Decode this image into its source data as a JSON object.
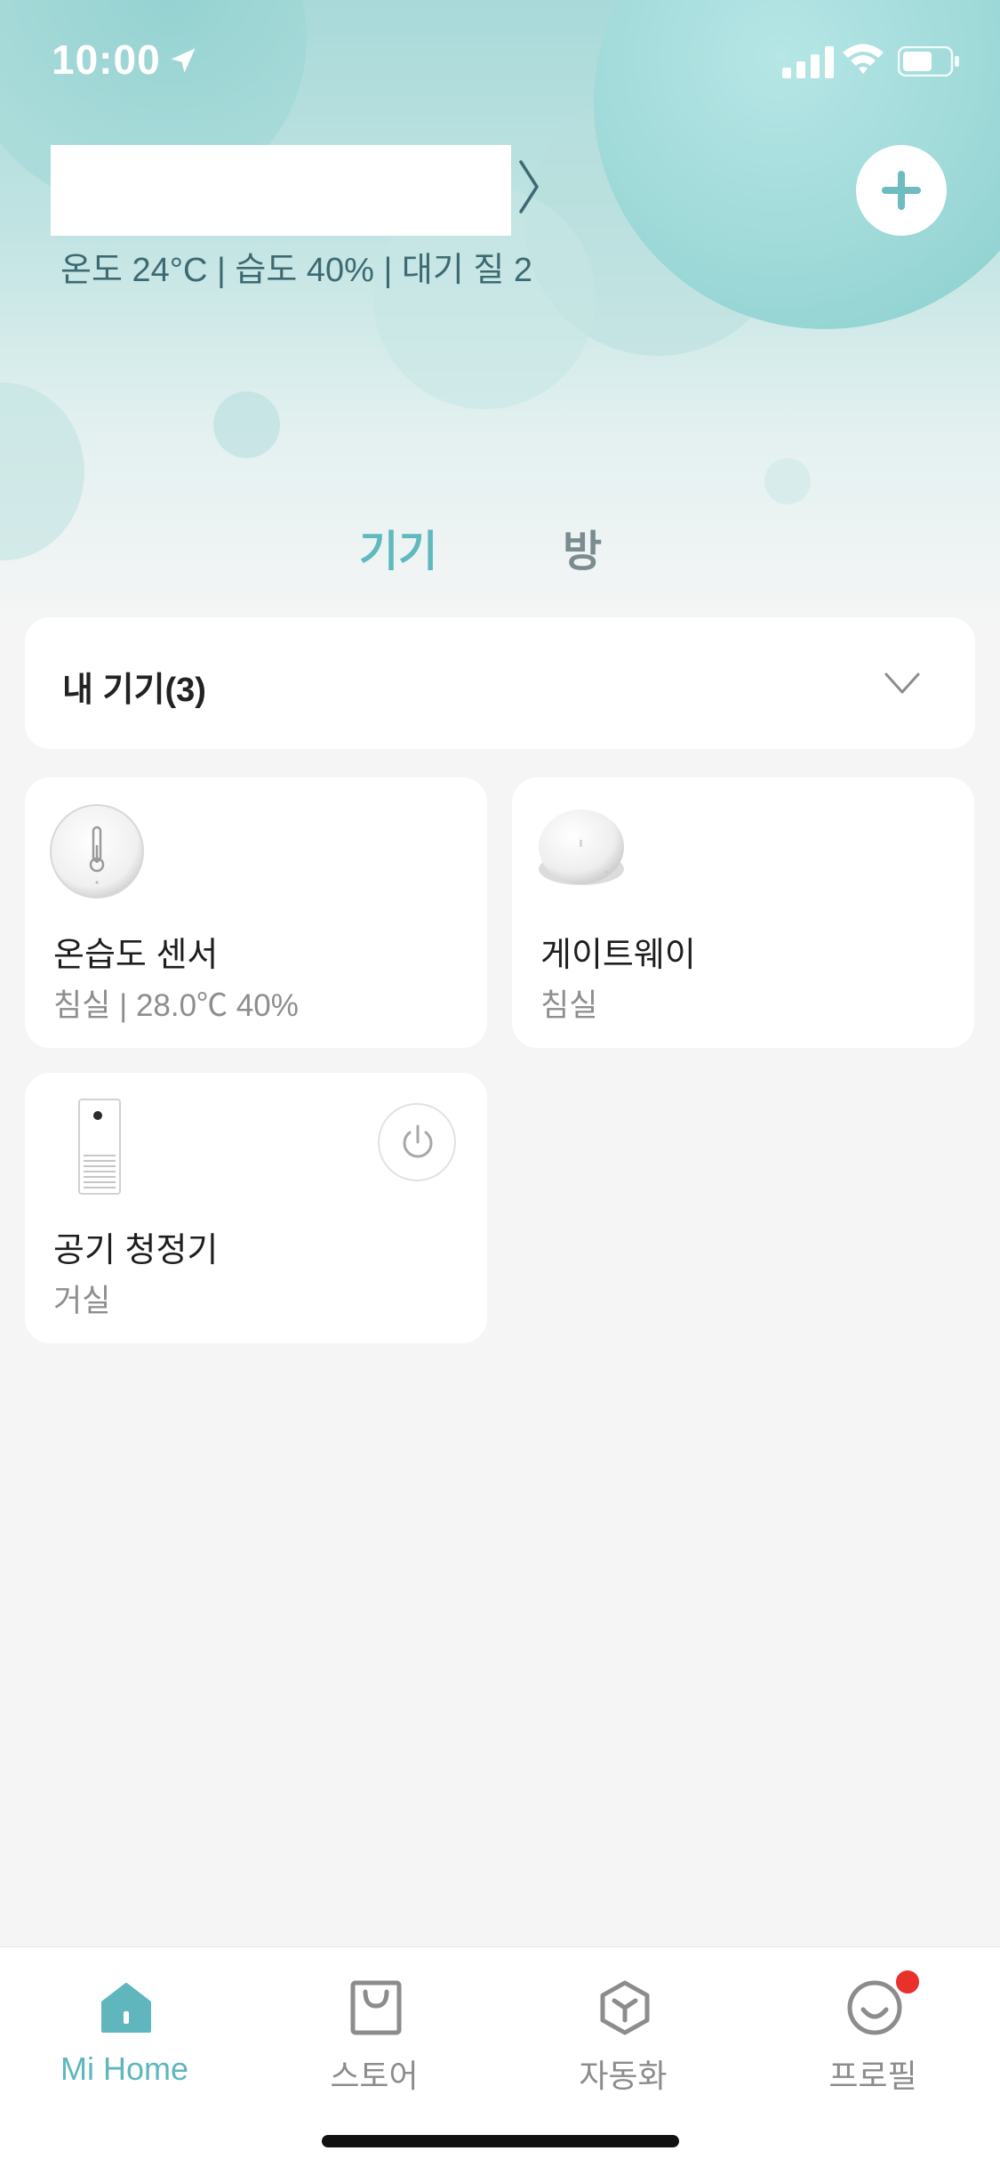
{
  "status_bar": {
    "time": "10:00"
  },
  "header": {
    "home_stats": "온도 24°C | 습도 40% | 대기 질 2"
  },
  "tabs": [
    {
      "label": "기기",
      "active": true
    },
    {
      "label": "방",
      "active": false
    }
  ],
  "device_group": {
    "label": "내 기기(3)"
  },
  "devices": [
    {
      "name": "온습도 센서",
      "meta": "침실 | 28.0℃ 40%",
      "icon": "thermometer-sensor-icon"
    },
    {
      "name": "게이트웨이",
      "meta": "침실",
      "icon": "gateway-icon"
    },
    {
      "name": "공기 청정기",
      "meta": "거실",
      "icon": "air-purifier-icon",
      "has_power_button": true
    }
  ],
  "bottom_nav": [
    {
      "label": "Mi Home",
      "icon": "home-icon",
      "active": true
    },
    {
      "label": "스토어",
      "icon": "store-bag-icon",
      "active": false
    },
    {
      "label": "자동화",
      "icon": "automation-icon",
      "active": false
    },
    {
      "label": "프로필",
      "icon": "profile-smile-icon",
      "active": false,
      "badge": true
    }
  ],
  "colors": {
    "accent": "#5fb6bd",
    "badge": "#e8312b",
    "hero_teal": "#9ed9d8"
  }
}
